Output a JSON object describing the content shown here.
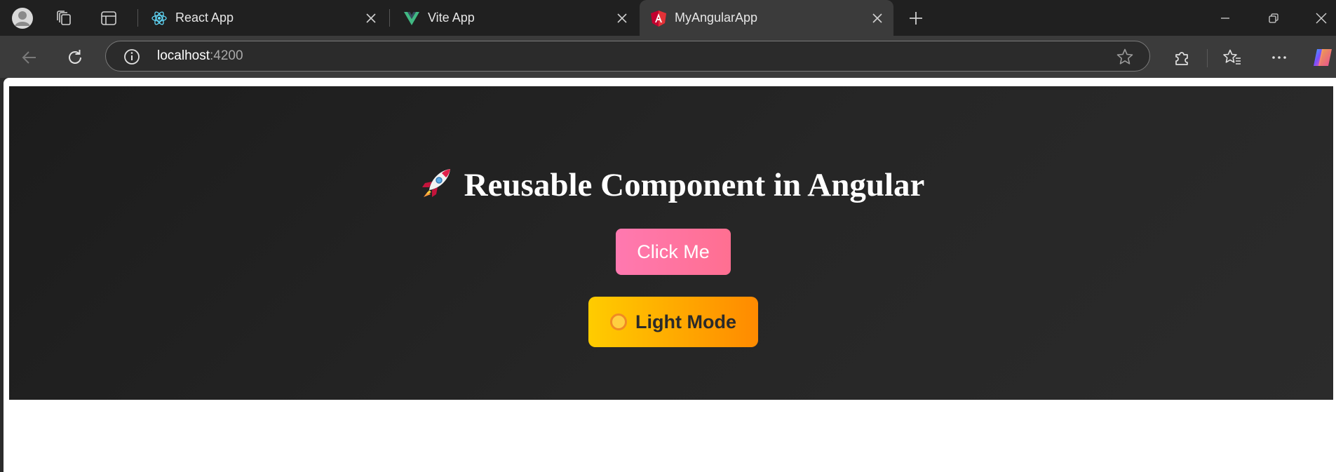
{
  "browser": {
    "tabs": [
      {
        "title": "React App",
        "favicon": "react-icon",
        "active": false
      },
      {
        "title": "Vite App",
        "favicon": "vite-icon",
        "active": false
      },
      {
        "title": "MyAngularApp",
        "favicon": "angular-icon",
        "active": true
      }
    ],
    "address_bar": {
      "host": "localhost",
      "port": ":4200"
    }
  },
  "page": {
    "heading": "Reusable Component in Angular",
    "heading_emoji": "rocket-icon",
    "click_button_label": "Click Me",
    "mode_button_label": "Light Mode",
    "mode_button_icon": "sun-icon"
  },
  "colors": {
    "hero_background": "#232323",
    "click_button": "#ff79b0",
    "mode_button_start": "#ffcc00",
    "mode_button_end": "#ff8a00"
  }
}
